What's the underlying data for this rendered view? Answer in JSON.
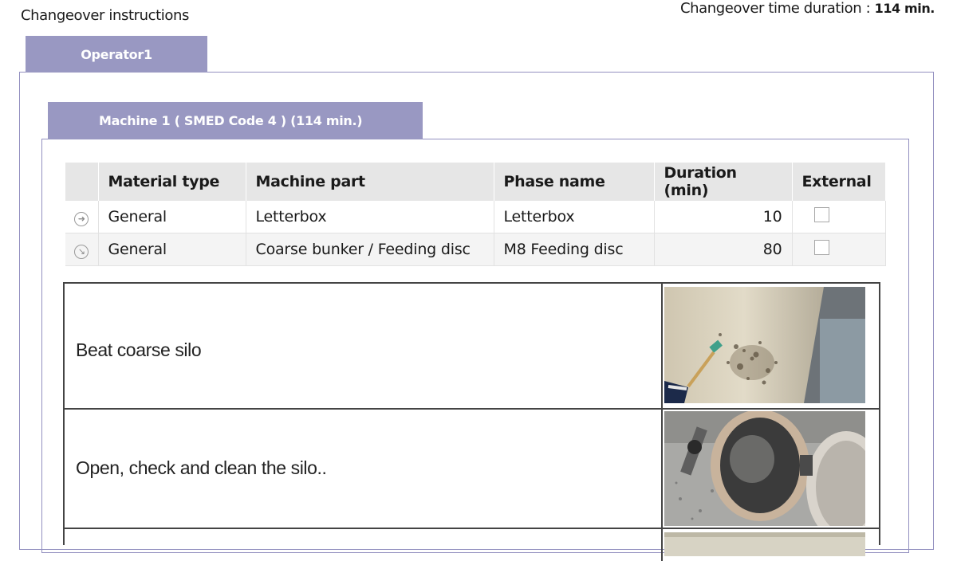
{
  "header": {
    "title": "Changeover instructions",
    "duration_label": "Changeover time duration :",
    "duration_value": "114 min."
  },
  "tabs": {
    "operator": "Operator1",
    "machine": "Machine 1 ( SMED Code 4 ) (114 min.)"
  },
  "table": {
    "columns": [
      "Material type",
      "Machine part",
      "Phase name",
      "Duration (min)",
      "External"
    ],
    "rows": [
      {
        "icon": "arrow-right-circle-icon",
        "material_type": "General",
        "machine_part": "Letterbox",
        "phase_name": "Letterbox",
        "duration": "10",
        "external": false
      },
      {
        "icon": "arrow-down-right-circle-icon",
        "material_type": "General",
        "machine_part": "Coarse bunker / Feeding disc",
        "phase_name": "M8 Feeding disc",
        "duration": "80",
        "external": false
      }
    ]
  },
  "steps": [
    {
      "text": "Beat coarse silo",
      "photo": "silo-hammer-photo"
    },
    {
      "text": "Open, check and clean the silo..",
      "photo": "silo-opening-photo"
    },
    {
      "text": "",
      "photo": "next-step-photo"
    }
  ],
  "colors": {
    "tab_background": "#9998c2",
    "panel_border": "#9390c0",
    "header_background": "#e6e6e6"
  }
}
